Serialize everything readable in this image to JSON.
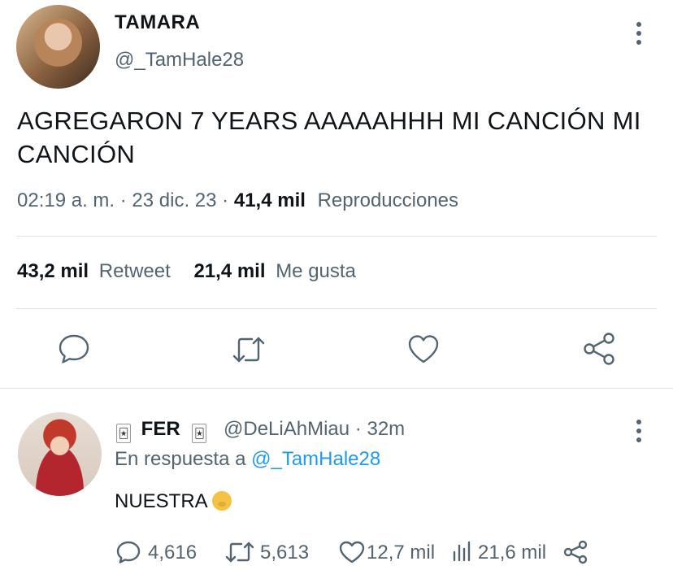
{
  "tweet": {
    "display_name": "TAMARA",
    "handle": "@_TamHale28",
    "text": "AGREGARON 7 YEARS AAAAAHHH MI CANCIÓN MI CANCIÓN",
    "time": "02:19 a. m.",
    "date": "23 dic. 23",
    "views_count": "41,4 mil",
    "views_label": "Reproducciones",
    "retweets_count": "43,2 mil",
    "retweets_label": "Retweet",
    "likes_count": "21,4 mil",
    "likes_label": "Me gusta",
    "action_icons": [
      "reply-icon",
      "retweet-icon",
      "like-icon",
      "share-icon"
    ]
  },
  "reply": {
    "display_name": "FER",
    "handle": "@DeLiAhMiau",
    "age": "32m",
    "reply_to_label": "En respuesta a",
    "reply_to_handle": "@_TamHale28",
    "text": "NUESTRA",
    "replies_count": "4,616",
    "retweets_count": "5,613",
    "likes_count": "12,7 mil",
    "views_count": "21,6 mil",
    "action_icons": [
      "reply-icon",
      "retweet-icon",
      "like-icon",
      "views-icon",
      "share-icon"
    ]
  },
  "colors": {
    "text": "#0f1419",
    "secondary": "#536471",
    "link": "#1d9bf0",
    "divider": "#dfe3e7"
  }
}
